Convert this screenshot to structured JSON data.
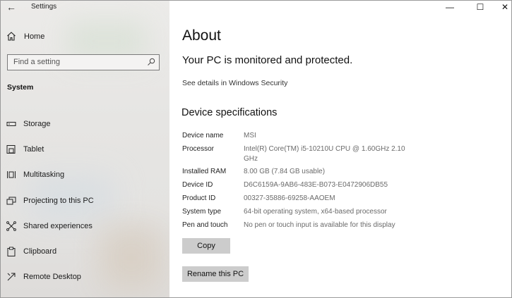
{
  "window": {
    "title": "Settings",
    "controls": {
      "minimize": "—",
      "maximize": "☐",
      "close": "✕"
    }
  },
  "sidebar": {
    "home_label": "Home",
    "search_placeholder": "Find a setting",
    "section_label": "System",
    "items": [
      {
        "label": "Storage",
        "icon": "storage-icon"
      },
      {
        "label": "Tablet",
        "icon": "tablet-icon"
      },
      {
        "label": "Multitasking",
        "icon": "multitasking-icon"
      },
      {
        "label": "Projecting to this PC",
        "icon": "projecting-icon"
      },
      {
        "label": "Shared experiences",
        "icon": "shared-experiences-icon"
      },
      {
        "label": "Clipboard",
        "icon": "clipboard-icon"
      },
      {
        "label": "Remote Desktop",
        "icon": "remote-desktop-icon"
      }
    ]
  },
  "main": {
    "title": "About",
    "protection_status": "Your PC is monitored and protected.",
    "security_link": "See details in Windows Security",
    "specs_title": "Device specifications",
    "specs": [
      {
        "label": "Device name",
        "value": "MSI"
      },
      {
        "label": "Processor",
        "value": "Intel(R) Core(TM) i5-10210U CPU @ 1.60GHz   2.10 GHz"
      },
      {
        "label": "Installed RAM",
        "value": "8.00 GB (7.84 GB usable)"
      },
      {
        "label": "Device ID",
        "value": "D6C6159A-9AB6-483E-B073-E0472906DB55"
      },
      {
        "label": "Product ID",
        "value": "00327-35886-69258-AAOEM"
      },
      {
        "label": "System type",
        "value": "64-bit operating system, x64-based processor"
      },
      {
        "label": "Pen and touch",
        "value": "No pen or touch input is available for this display"
      }
    ],
    "copy_button": "Copy",
    "rename_button": "Rename this PC"
  }
}
